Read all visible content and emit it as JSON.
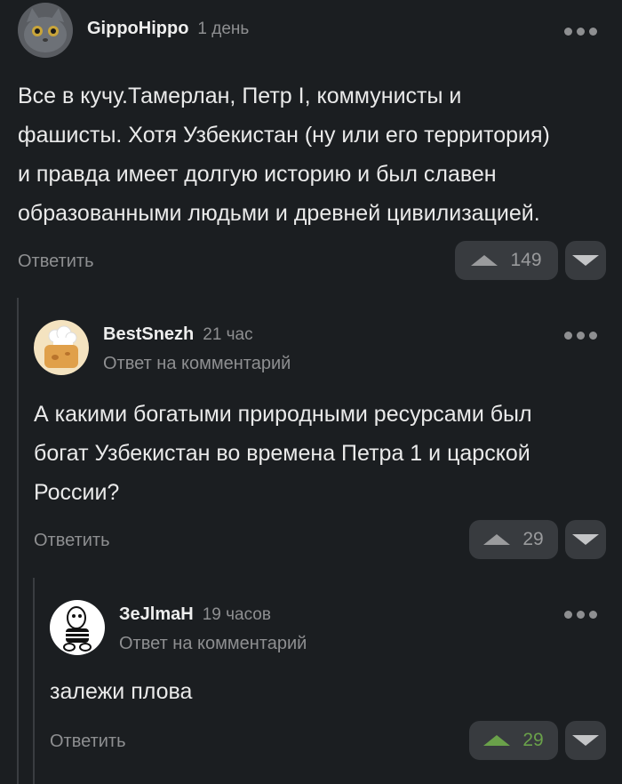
{
  "comments": [
    {
      "author": "GippoHippo",
      "time": "1 день",
      "reply_to": "",
      "text": "Все в кучу.Тамерлан, Петр I, коммунисты и\nфашисты. Хотя Узбекистан (ну или его территория)\nи правда имеет долгую историю и был славен\nобразованными людьми и древней цивилизацией.",
      "reply_label": "Ответить",
      "score": "149",
      "avatar_icon": "cat-avatar-icon"
    },
    {
      "author": "BestSnezh",
      "time": "21 час",
      "reply_to": "Ответ на комментарий",
      "text": "А какими богатыми природными ресурсами был\nбогат Узбекистан во времена Петра 1 и царской\nРоссии?",
      "reply_label": "Ответить",
      "score": "29",
      "avatar_icon": "chef-avatar-icon"
    },
    {
      "author": "ЗеJlmaH",
      "time": "19 часов",
      "reply_to": "Ответ на комментарий",
      "text": "залежи плова",
      "reply_label": "Ответить",
      "score": "29",
      "avatar_icon": "cartoon-avatar-icon",
      "upvoted": true
    }
  ],
  "colors": {
    "background": "#1b1e21",
    "upvote_active": "#6aa14a",
    "muted": "#8e8f91"
  }
}
